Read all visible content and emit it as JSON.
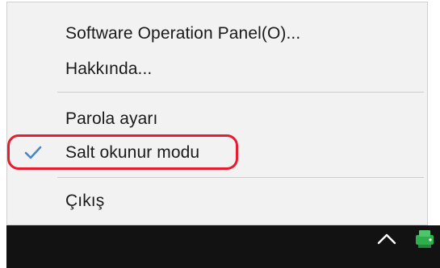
{
  "menu": {
    "items": [
      {
        "label": "Software Operation Panel(O)..."
      },
      {
        "label": "Hakkında..."
      },
      {
        "label": "Parola ayarı"
      },
      {
        "label": "Salt okunur modu",
        "checked": true
      },
      {
        "label": "Çıkış"
      }
    ]
  },
  "icons": {
    "check": "checkmark-icon",
    "chevron": "chevron-up-icon",
    "tray": "scanner-tray-icon"
  },
  "colors": {
    "menu_bg": "#f2f2f2",
    "check": "#4a86c8",
    "highlight": "#e81c2e",
    "taskbar": "#121212",
    "tray_icon": "#2fae4e"
  }
}
